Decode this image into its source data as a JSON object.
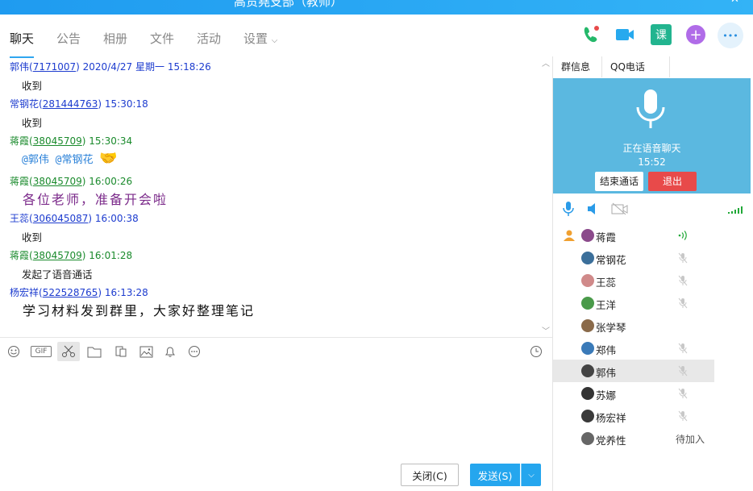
{
  "window": {
    "title": "高货堯支部（教师）",
    "ctrl_min": "—",
    "ctrl_close": "✕"
  },
  "tabs": [
    {
      "label": "聊天",
      "active": true
    },
    {
      "label": "公告"
    },
    {
      "label": "相册"
    },
    {
      "label": "文件"
    },
    {
      "label": "活动"
    },
    {
      "label": "设置"
    }
  ],
  "top_buttons": [
    {
      "name": "voice-call-icon",
      "label": ""
    },
    {
      "name": "video-call-icon",
      "label": ""
    },
    {
      "name": "class-icon",
      "label": "课"
    },
    {
      "name": "add-app-icon",
      "label": "+"
    },
    {
      "name": "more-icon",
      "label": "•••"
    }
  ],
  "messages": [
    {
      "sender": "郭伟",
      "qq": "7171007",
      "time": "2020/4/27 星期一 15:18:26",
      "color": "#1d3ccf",
      "body": "收到"
    },
    {
      "sender": "常钢花",
      "qq": "281444763",
      "time": "15:30:18",
      "color": "#1d3ccf",
      "body": "收到"
    },
    {
      "sender": "蒋霞",
      "qq": "38045709",
      "time": "15:30:34",
      "color": "#1a8a2c",
      "body": "@郭伟 @常钢花",
      "emoji": "🤝"
    },
    {
      "sender": "蒋霞",
      "qq": "38045709",
      "time": "16:00:26",
      "color": "#1a8a2c",
      "body": "各位老师，准备开会啦"
    },
    {
      "sender": "王蕊",
      "qq": "306045087",
      "time": "16:00:38",
      "color": "#1d3ccf",
      "body": "收到"
    },
    {
      "sender": "蒋霞",
      "qq": "38045709",
      "time": "16:01:28",
      "color": "#1a8a2c",
      "body": "发起了语音通话"
    },
    {
      "sender": "杨宏祥",
      "qq": "522528765",
      "time": "16:13:28",
      "color": "#1d3ccf",
      "body": "学习材料发到群里，大家好整理笔记"
    }
  ],
  "toolbar": {
    "icons": [
      "emoji-icon",
      "gif-icon",
      "screenshot-icon",
      "folder-icon",
      "image-file-icon",
      "image-icon",
      "bell-icon",
      "more-options-icon"
    ],
    "gif_label": "GIF",
    "history_icon": "clock-icon"
  },
  "buttons": {
    "close": "关闭(C)",
    "send": "发送(S)"
  },
  "right": {
    "tabs": [
      "群信息",
      "QQ电话"
    ],
    "voice_status": "正在语音聊天",
    "voice_time": "15:52",
    "end_call": "结束通话",
    "exit": "退出"
  },
  "members": [
    {
      "name": "蒋霞",
      "status": "speaking",
      "status_text": "",
      "owner": true,
      "av": "#8b4a8b"
    },
    {
      "name": "常钢花",
      "status": "muted",
      "status_text": "",
      "av": "#3b6f9a"
    },
    {
      "name": "王蕊",
      "status": "muted",
      "status_text": "",
      "av": "#d08a8a"
    },
    {
      "name": "王洋",
      "status": "muted",
      "status_text": "",
      "av": "#4a9a4a"
    },
    {
      "name": "张学琴",
      "status": "none",
      "status_text": "",
      "av": "#8a6a4a"
    },
    {
      "name": "郑伟",
      "status": "muted",
      "status_text": "",
      "av": "#3a7ab8"
    },
    {
      "name": "郭伟",
      "status": "muted",
      "status_text": "",
      "av": "#444444",
      "selected": true
    },
    {
      "name": "苏娜",
      "status": "muted",
      "status_text": "",
      "av": "#333333"
    },
    {
      "name": "杨宏祥",
      "status": "muted",
      "status_text": "",
      "av": "#3a3a3a"
    },
    {
      "name": "党养性",
      "status": "waiting",
      "status_text": "待加入",
      "av": "#666666"
    }
  ],
  "colors": {
    "accent": "#2fa6f0",
    "voice_bg": "#5bb8e0",
    "exit_red": "#e84a4a",
    "send_blue": "#25a6ee"
  }
}
